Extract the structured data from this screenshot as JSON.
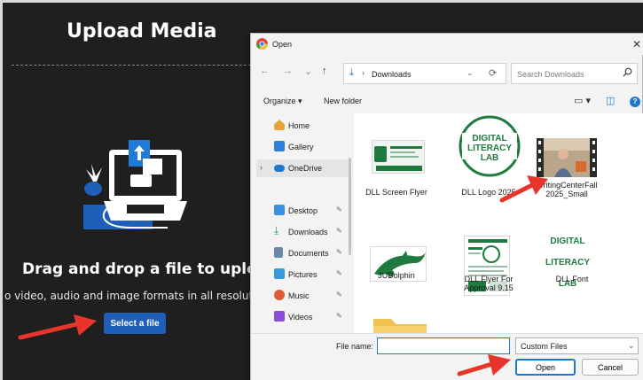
{
  "upload": {
    "title": "Upload Media",
    "drag_text": "Drag and drop a file to upload",
    "formats_text": "o video, audio and image formats in all resolutions a",
    "select_button": "Select a file"
  },
  "dialog": {
    "title": "Open",
    "close_glyph": "✕",
    "nav": {
      "back": "←",
      "forward": "→",
      "recent": "⌄",
      "up": "↑",
      "separator": "›",
      "location": "Downloads",
      "dropdown": "⌄",
      "refresh": "⟳",
      "search_placeholder": "Search Downloads"
    },
    "toolbar": {
      "organize": "Organize ▾",
      "new_folder": "New folder",
      "view_icon": "▭ ▾",
      "preview_icon": "◫",
      "help": "?"
    },
    "sidebar": [
      {
        "label": "Home",
        "icon": "home-icon",
        "color": "#e8a33d",
        "pinned": false
      },
      {
        "label": "Gallery",
        "icon": "gallery-icon",
        "color": "#2f7fd8",
        "pinned": false
      },
      {
        "label": "OneDrive",
        "icon": "onedrive-icon",
        "color": "#1e77c8",
        "pinned": false
      },
      {
        "label": "Desktop",
        "icon": "desktop-icon",
        "color": "#3d8fe0",
        "pinned": true
      },
      {
        "label": "Downloads",
        "icon": "download-icon",
        "color": "#1e9f6a",
        "pinned": true
      },
      {
        "label": "Documents",
        "icon": "documents-icon",
        "color": "#6a88a8",
        "pinned": true
      },
      {
        "label": "Pictures",
        "icon": "pictures-icon",
        "color": "#3a9ad9",
        "pinned": true
      },
      {
        "label": "Music",
        "icon": "music-icon",
        "color": "#e05a3a",
        "pinned": true
      },
      {
        "label": "Videos",
        "icon": "videos-icon",
        "color": "#8a4fd8",
        "pinned": true
      }
    ],
    "onedrive_chevron": "›",
    "pin_glyph": "📌",
    "files": [
      {
        "name": "DLL Screen Flyer"
      },
      {
        "name": "DLL Logo 2025",
        "logo_lines": [
          "DIGITAL",
          "LITERACY",
          "LAB"
        ]
      },
      {
        "name": "WritingCenterFall 2025_Small"
      },
      {
        "name": "JUDolphin"
      },
      {
        "name": "DLL Flyer For Approval 9.15"
      },
      {
        "name": "DLL Font",
        "logo_lines": [
          "DIGITAL",
          "LITERACY",
          "LAB"
        ]
      }
    ],
    "bottom": {
      "filename_label": "File name:",
      "filename_value": "",
      "filetype": "Custom Files",
      "filetype_chevron": "⌄",
      "open_button": "Open",
      "cancel_button": "Cancel"
    }
  },
  "colors": {
    "accent_blue": "#1e77c8",
    "upload_button": "#1f5fb8",
    "annotation_red": "#e8352c",
    "brand_green": "#1e7a3f"
  }
}
